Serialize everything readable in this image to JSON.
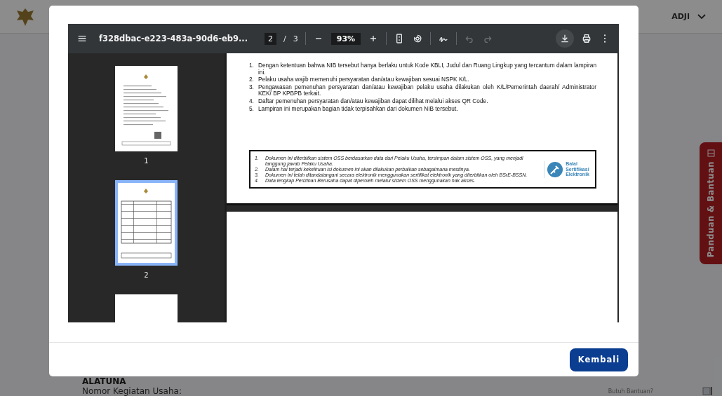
{
  "background_page": {
    "user_name": "ADJI",
    "section_title": "ALATUNA",
    "field_label": "Nomor Kegiatan Usaha:",
    "help_text": "Butuh Bantuan?",
    "help_tab": "Panduan & Bantuan"
  },
  "modal": {
    "viewer": {
      "toolbar": {
        "file_name": "f328dbac-e223-483a-90d6-eb9...",
        "page_input": "2",
        "page_separator": "/",
        "page_total": "3",
        "zoom": "93%",
        "undo": {
          "disabled": true
        },
        "redo": {
          "disabled": true
        }
      },
      "thumbnails": [
        {
          "label": "1",
          "selected": false
        },
        {
          "label": "2",
          "selected": true
        },
        {
          "selected": false
        }
      ],
      "document": {
        "items": [
          {
            "number": "1.",
            "text": "Dengan ketentuan bahwa NIB tersebut hanya berlaku untuk Kode KBLI, Judul dan Ruang Lingkup yang tercantum dalam lampiran ini."
          },
          {
            "number": "2.",
            "text": "Pelaku usaha wajib memenuhi persyaratan dan/atau kewajiban sesuai NSPK K/L."
          },
          {
            "number": "3.",
            "text": "Pengawasan pemenuhan persyaratan dan/atau kewajiban pelaku usaha dilakukan oleh K/L/Pemerintah daerah/ Administrator KEK/ BP KPBPB terkait."
          },
          {
            "number": "4.",
            "text": "Daftar pemenuhan persyaratan dan/atau kewajiban dapat dilihat melalui akses QR Code."
          },
          {
            "number": "5.",
            "text": "Lampiran ini merupakan bagian tidak terpisahkan dari dokumen NIB tersebut."
          }
        ],
        "notes": [
          {
            "number": "1.",
            "text": "Dokumen ini diterbitkan sistem OSS berdasarkan data dari Pelaku Usaha, tersimpan dalam sistem OSS, yang menjadi tanggung jawab Pelaku Usaha."
          },
          {
            "number": "2.",
            "text": "Dalam hal terjadi kekeliruan isi dokumen ini akan dilakukan perbaikan sebagaimana mestinya."
          },
          {
            "number": "3.",
            "text": "Dokumen ini telah ditandatangani secara elektronik menggunakan sertifikat elektronik yang diterbitkan oleh BSrE-BSSN."
          },
          {
            "number": "4.",
            "text": "Data lengkap Perizinan Berusaha dapat diperoleh melalui sistem OSS menggunakan hak akses."
          }
        ],
        "seal_text": [
          "Balai",
          "Sertifikasi",
          "Elektronik"
        ]
      }
    },
    "buttons": [
      "Kembali"
    ]
  }
}
